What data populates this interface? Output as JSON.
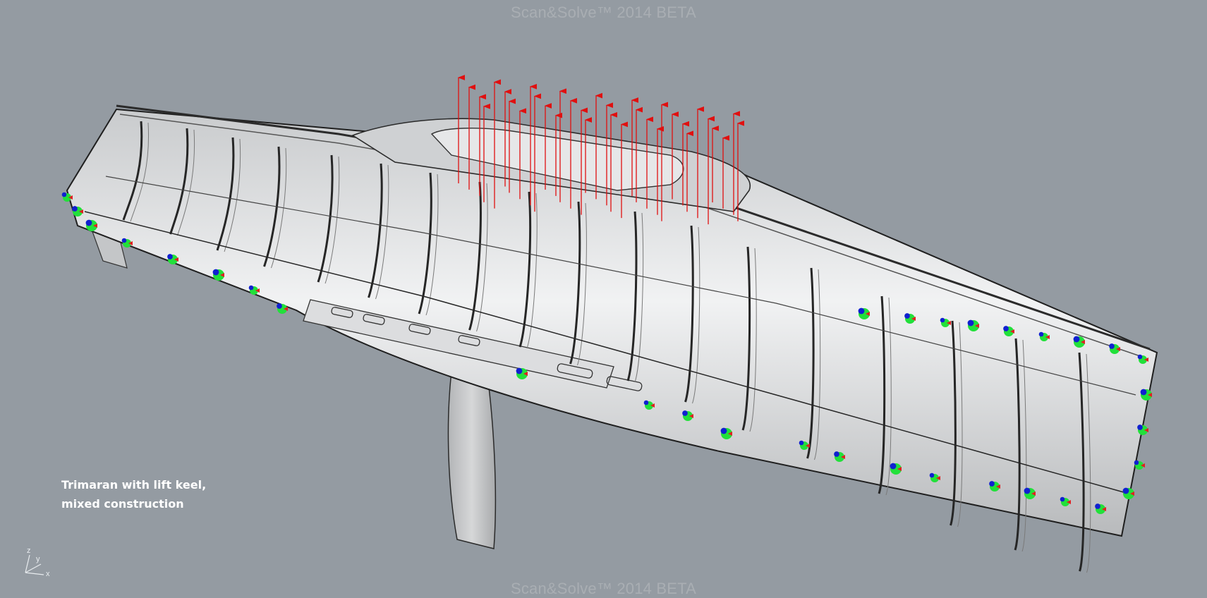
{
  "watermark": {
    "top": "Scan&Solve™ 2014 BETA",
    "bottom": "Scan&Solve™ 2014 BETA"
  },
  "caption": {
    "line1": "Trimaran with lift keel,",
    "line2": "mixed construction"
  },
  "axes_widget": {
    "z": "z",
    "y": "y",
    "x": "x"
  },
  "colors": {
    "background": "#949ba2",
    "hull": "#d9dadb",
    "load_arrows": "#e01010",
    "restraint_green": "#22e03a",
    "restraint_blue": "#1020d0",
    "restraint_red": "#e02020"
  }
}
